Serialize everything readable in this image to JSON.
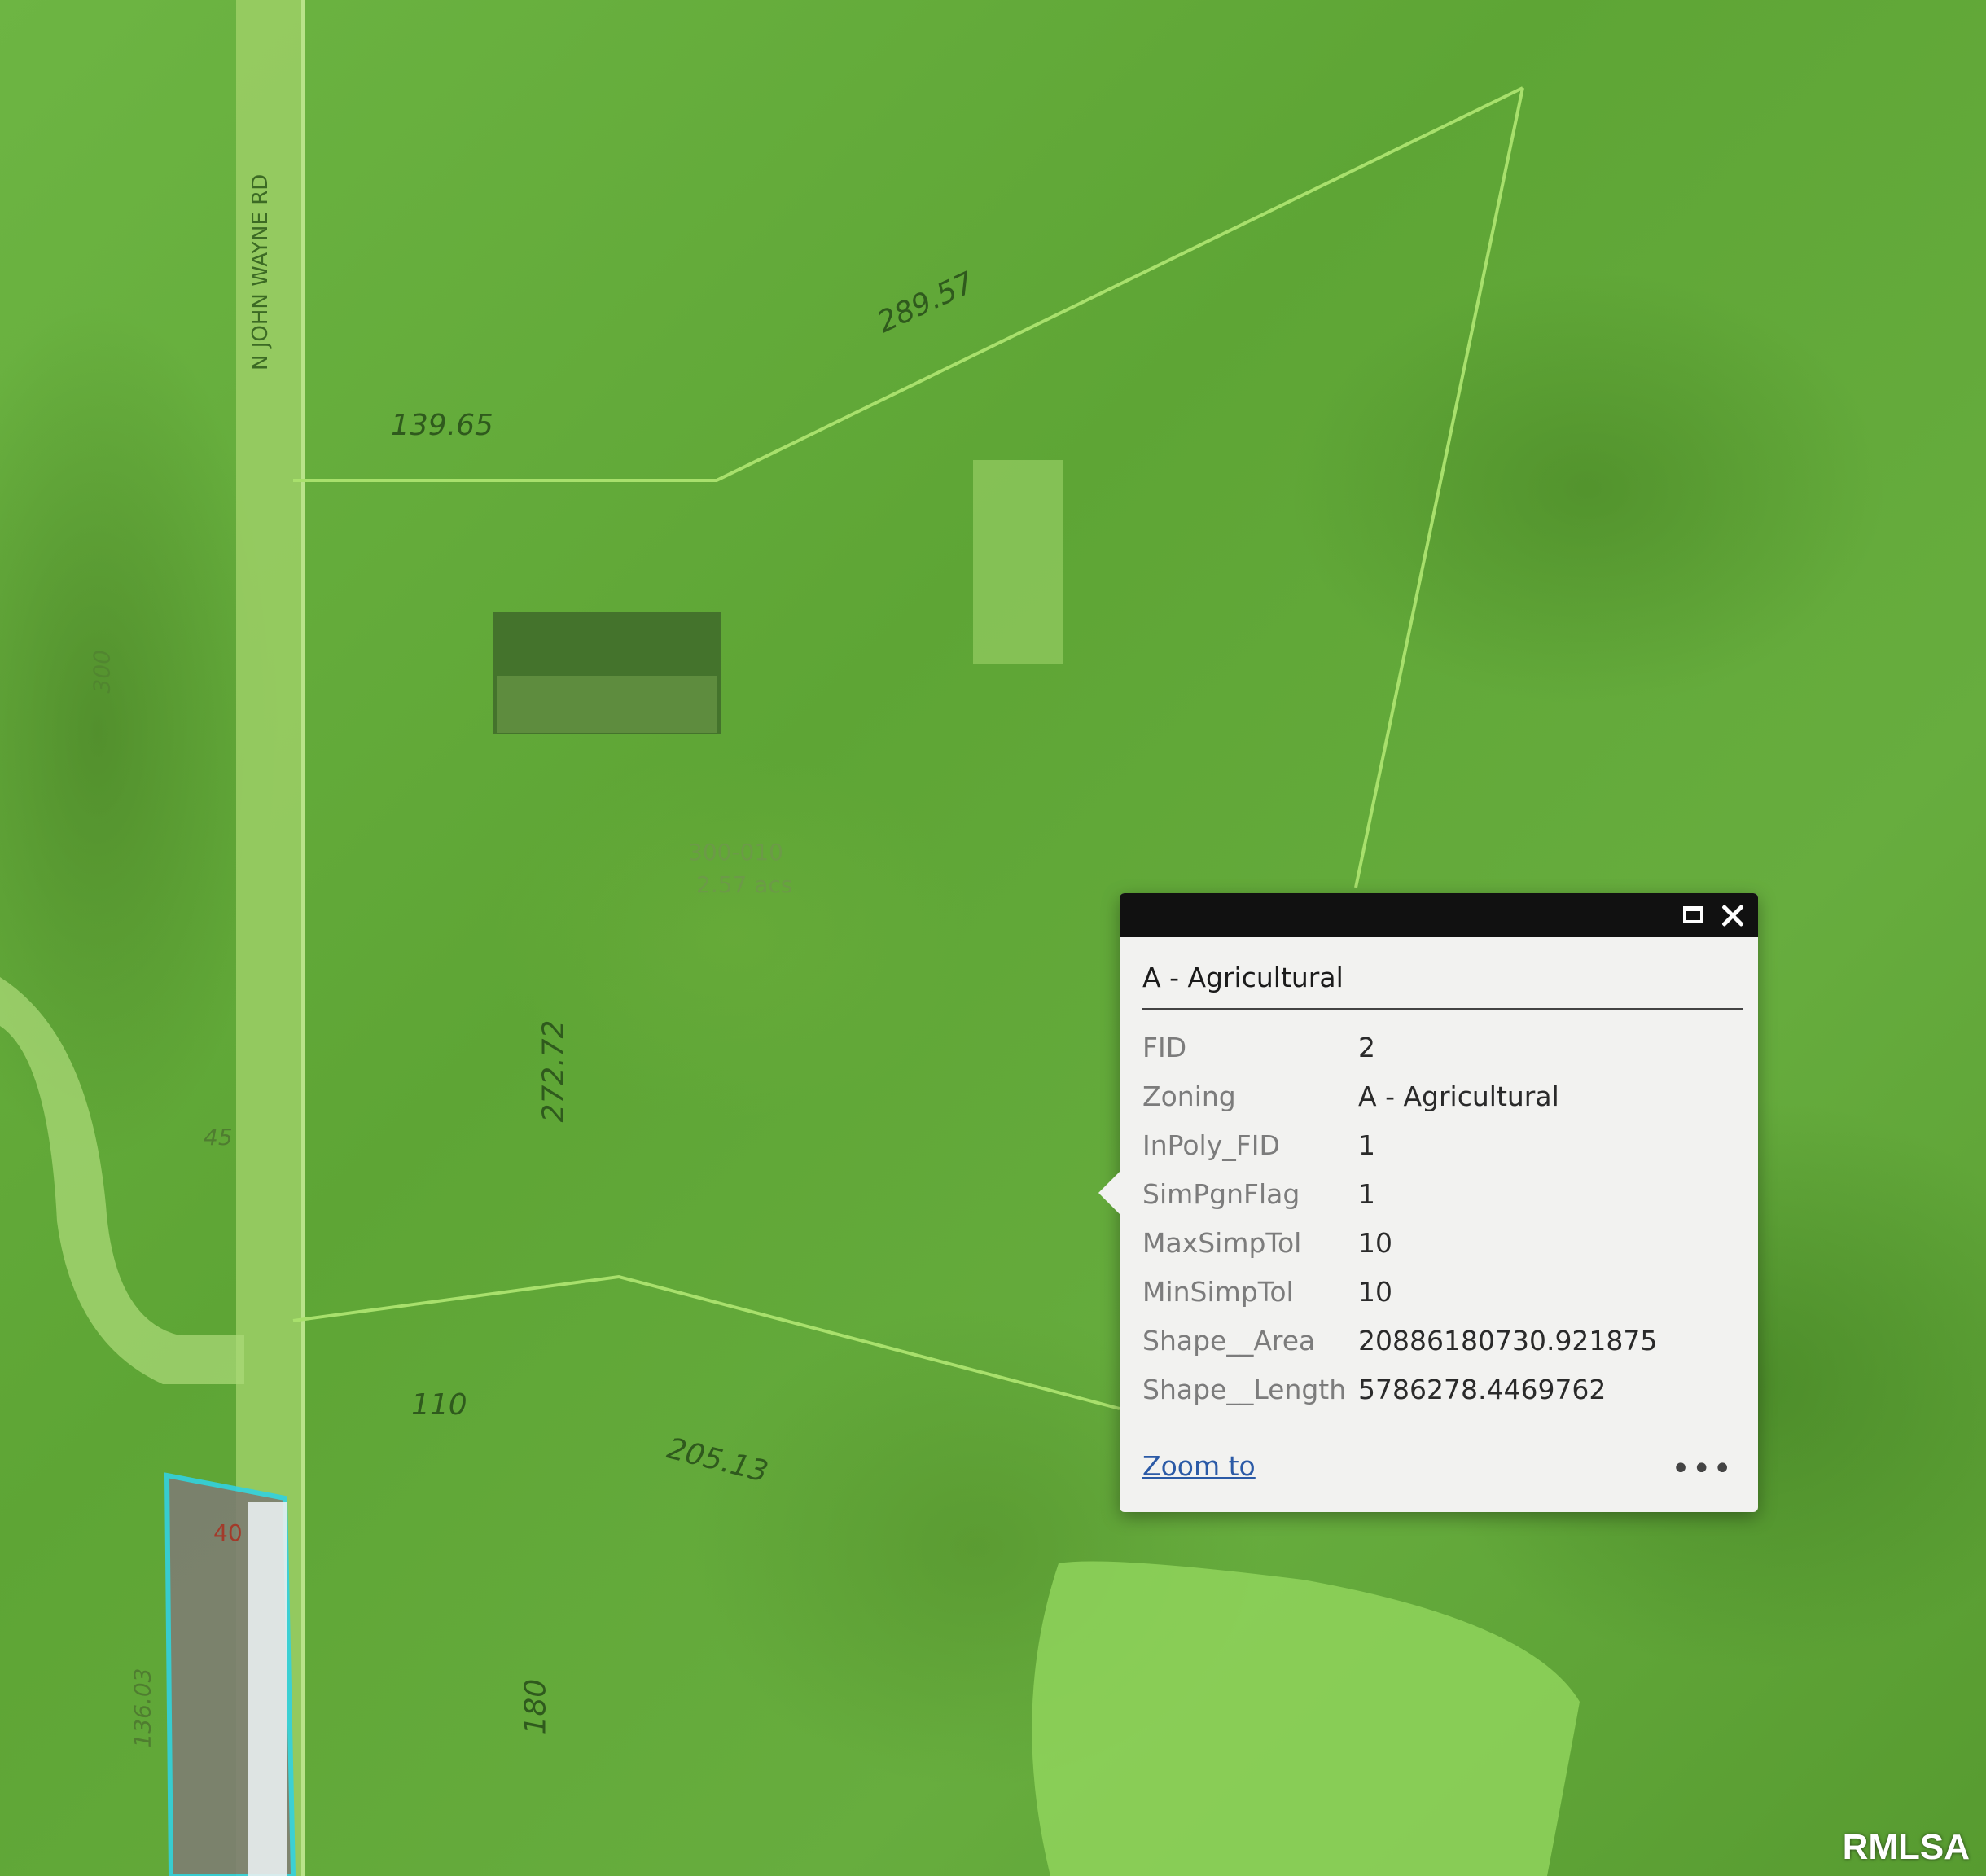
{
  "map": {
    "road_label": "N JOHN WAYNE RD",
    "parcel_id": "300-010",
    "parcel_area": "2.57 acs",
    "dimension_labels": [
      "289.57",
      "139.65",
      "272.72",
      "110",
      "205.13",
      "180",
      "136.03",
      "45",
      "40",
      "300"
    ]
  },
  "popup": {
    "title": "A - Agricultural",
    "attributes": [
      {
        "name": "FID",
        "value": "2"
      },
      {
        "name": "Zoning",
        "value": "A - Agricultural"
      },
      {
        "name": "InPoly_FID",
        "value": "1"
      },
      {
        "name": "SimPgnFlag",
        "value": "1"
      },
      {
        "name": "MaxSimpTol",
        "value": "10"
      },
      {
        "name": "MinSimpTol",
        "value": "10"
      },
      {
        "name": "Shape__Area",
        "value": "20886180730.921875"
      },
      {
        "name": "Shape__Length",
        "value": "5786278.4469762"
      }
    ],
    "zoom_label": "Zoom to",
    "more_label": "•••",
    "maximize_icon": "maximize-icon",
    "close_icon": "close-icon"
  },
  "watermark": "RMLSA",
  "colors": {
    "titlebar": "#111111",
    "link": "#2b5aa6",
    "parcel_outline": "#33d1e0"
  }
}
